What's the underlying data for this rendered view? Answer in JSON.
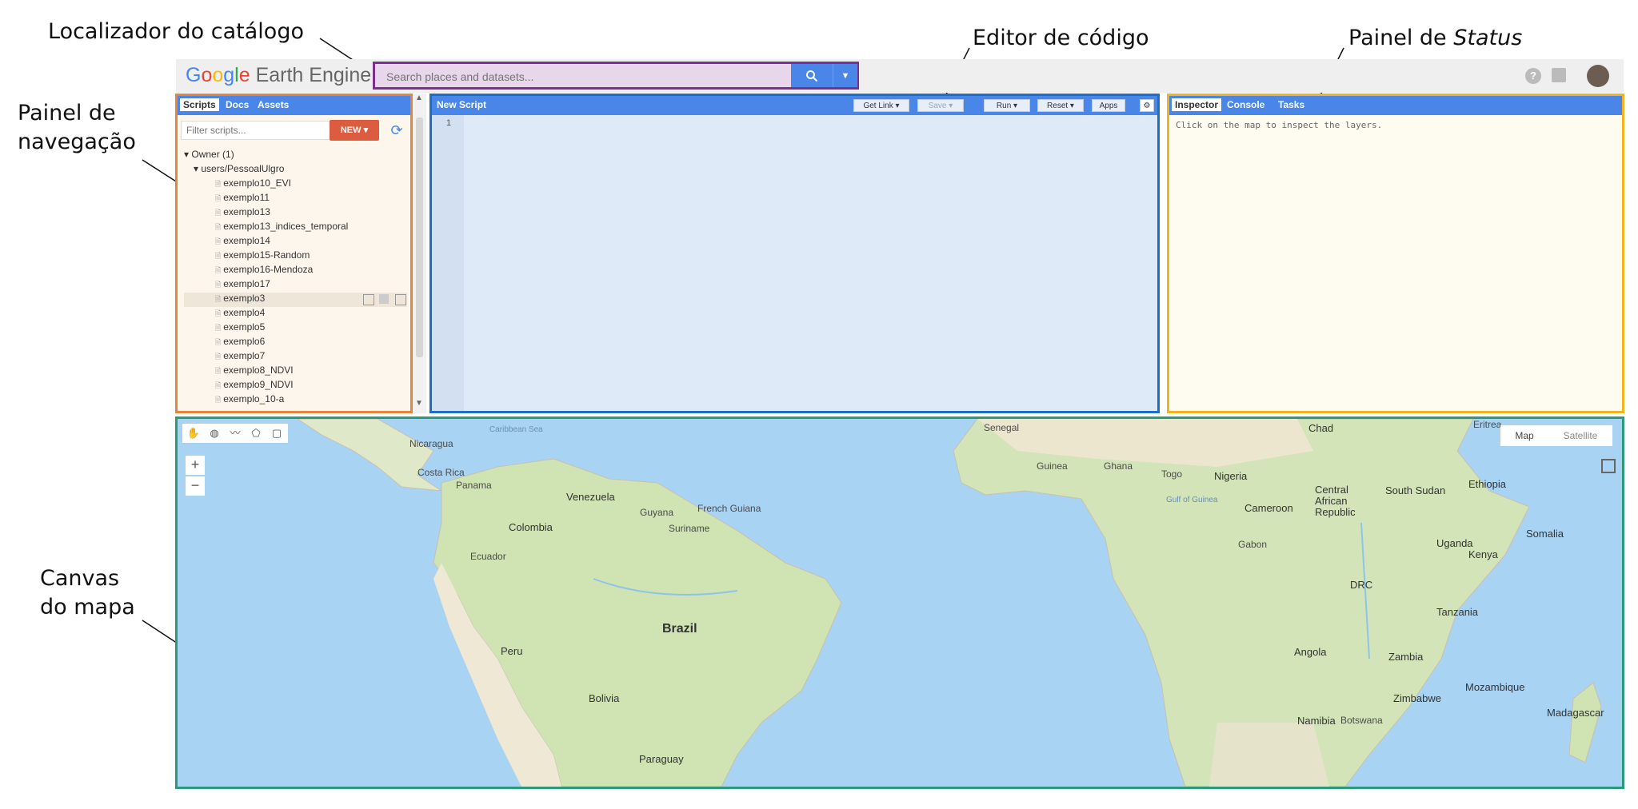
{
  "annotations": {
    "catalog": "Localizador do catálogo",
    "editor": "Editor de código",
    "status_prefix": "Painel de",
    "status_italic": "Status",
    "nav_line1": "Painel de",
    "nav_line2": "navegação",
    "map_line1": "Canvas",
    "map_line2": "do mapa"
  },
  "header": {
    "logo_google": [
      "G",
      "o",
      "o",
      "g",
      "l",
      "e"
    ],
    "logo_rest": " Earth Engine",
    "search_placeholder": "Search places and datasets..."
  },
  "nav_panel": {
    "tabs": [
      "Scripts",
      "Docs",
      "Assets"
    ],
    "filter_placeholder": "Filter scripts...",
    "new_label": "NEW",
    "tree_owner": "Owner (1)",
    "tree_user": "users/PessoalUlgro",
    "files": [
      "exemplo10_EVI",
      "exemplo11",
      "exemplo13",
      "exemplo13_indices_temporal",
      "exemplo14",
      "exemplo15-Random",
      "exemplo16-Mendoza",
      "exemplo17",
      "exemplo3",
      "exemplo4",
      "exemplo5",
      "exemplo6",
      "exemplo7",
      "exemplo8_NDVI",
      "exemplo9_NDVI",
      "exemplo_10-a"
    ]
  },
  "editor": {
    "title": "New Script",
    "buttons": [
      "Get Link",
      "Save",
      "Run",
      "Reset",
      "Apps"
    ],
    "line_number": "1"
  },
  "status_panel": {
    "tabs": [
      "Inspector",
      "Console",
      "Tasks"
    ],
    "message": "Click on the map to inspect the layers."
  },
  "map": {
    "type_buttons": [
      "Map",
      "Satellite"
    ],
    "zoom_in": "+",
    "zoom_out": "−",
    "labels": [
      {
        "text": "Brazil",
        "cls": "big"
      },
      {
        "text": "Colombia",
        "cls": "mid"
      },
      {
        "text": "Venezuela",
        "cls": "mid"
      },
      {
        "text": "Peru",
        "cls": "mid"
      },
      {
        "text": "Bolivia",
        "cls": "mid"
      },
      {
        "text": "Paraguay",
        "cls": "mid"
      },
      {
        "text": "Guyana",
        "cls": ""
      },
      {
        "text": "Suriname",
        "cls": ""
      },
      {
        "text": "French Guiana",
        "cls": ""
      },
      {
        "text": "Ecuador",
        "cls": ""
      },
      {
        "text": "Costa Rica",
        "cls": ""
      },
      {
        "text": "Panama",
        "cls": ""
      },
      {
        "text": "Nicaragua",
        "cls": ""
      },
      {
        "text": "Caribbean Sea",
        "cls": "sea"
      },
      {
        "text": "Chad",
        "cls": "mid"
      },
      {
        "text": "Nigeria",
        "cls": "mid"
      },
      {
        "text": "Central African Republic",
        "cls": "mid"
      },
      {
        "text": "South Sudan",
        "cls": "mid"
      },
      {
        "text": "Ethiopia",
        "cls": "mid"
      },
      {
        "text": "Cameroon",
        "cls": "mid"
      },
      {
        "text": "Gabon",
        "cls": ""
      },
      {
        "text": "DRC",
        "cls": "mid"
      },
      {
        "text": "Uganda",
        "cls": "mid"
      },
      {
        "text": "Kenya",
        "cls": "mid"
      },
      {
        "text": "Somalia",
        "cls": "mid"
      },
      {
        "text": "Tanzania",
        "cls": "mid"
      },
      {
        "text": "Angola",
        "cls": "mid"
      },
      {
        "text": "Zambia",
        "cls": "mid"
      },
      {
        "text": "Mozambique",
        "cls": "mid"
      },
      {
        "text": "Zimbabwe",
        "cls": "mid"
      },
      {
        "text": "Namibia",
        "cls": "mid"
      },
      {
        "text": "Botswana",
        "cls": ""
      },
      {
        "text": "Madagascar",
        "cls": "mid"
      },
      {
        "text": "Eritrea",
        "cls": ""
      },
      {
        "text": "Senegal",
        "cls": ""
      },
      {
        "text": "Guinea",
        "cls": ""
      },
      {
        "text": "Ghana",
        "cls": ""
      },
      {
        "text": "Togo",
        "cls": ""
      },
      {
        "text": "Gulf of Guinea",
        "cls": "sea"
      }
    ]
  }
}
